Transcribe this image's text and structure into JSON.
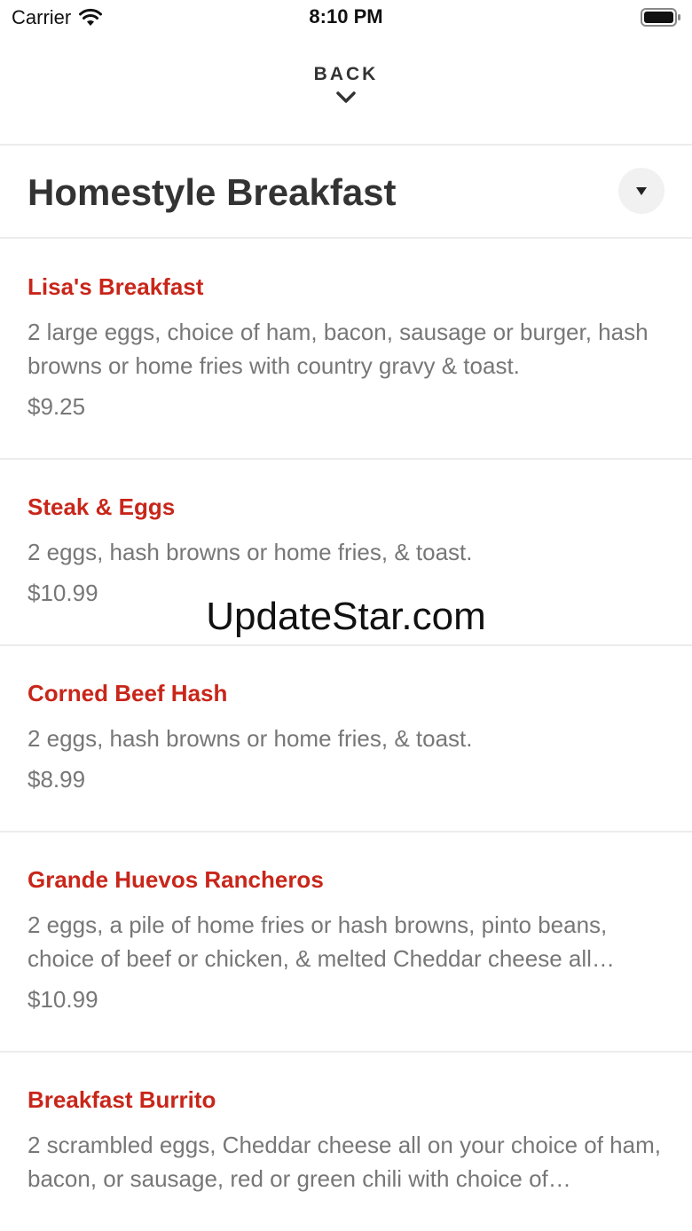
{
  "status_bar": {
    "carrier": "Carrier",
    "time": "8:10 PM"
  },
  "header": {
    "back_label": "BACK"
  },
  "section": {
    "title": "Homestyle Breakfast"
  },
  "menu_items": [
    {
      "name": "Lisa's Breakfast",
      "description": "2 large eggs, choice of ham, bacon, sausage or burger, hash browns or home fries with country gravy & toast.",
      "price": "$9.25"
    },
    {
      "name": "Steak & Eggs",
      "description": "2 eggs, hash browns or home fries, & toast.",
      "price": "$10.99"
    },
    {
      "name": "Corned Beef Hash",
      "description": "2 eggs, hash browns or home fries, & toast.",
      "price": "$8.99"
    },
    {
      "name": "Grande Huevos Rancheros",
      "description": "2 eggs, a pile of home fries or hash browns, pinto beans, choice of beef or chicken, & melted Cheddar cheese all…",
      "price": "$10.99"
    },
    {
      "name": "Breakfast Burrito",
      "description": "2 scrambled eggs, Cheddar cheese all on your choice of ham, bacon, or sausage, red or green chili with choice of…",
      "price": ""
    }
  ],
  "watermark": "UpdateStar.com",
  "colors": {
    "accent": "#c8261a",
    "text_secondary": "#777777",
    "divider": "#ececec"
  }
}
